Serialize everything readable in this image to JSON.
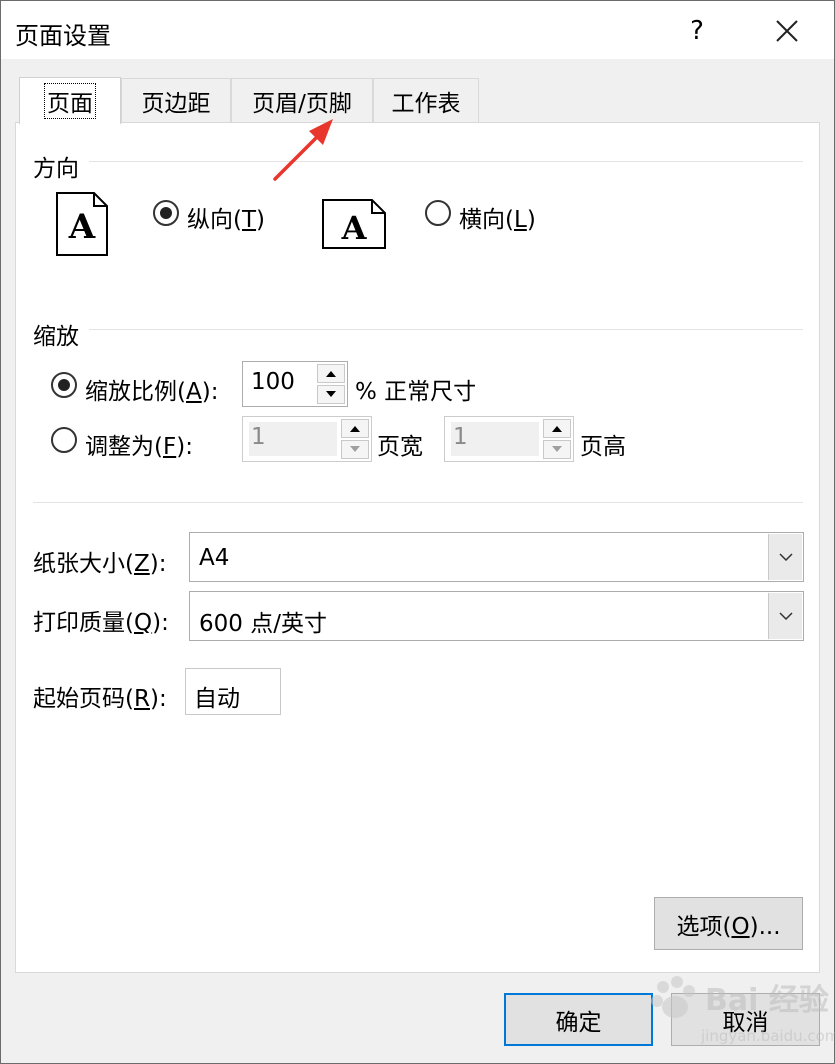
{
  "window": {
    "title": "页面设置",
    "help": "?"
  },
  "tabs": [
    {
      "label": "页面",
      "active": true
    },
    {
      "label": "页边距",
      "active": false
    },
    {
      "label": "页眉/页脚",
      "active": false
    },
    {
      "label": "工作表",
      "active": false
    }
  ],
  "orientation": {
    "title": "方向",
    "portrait": {
      "label": "纵向(",
      "key": "T",
      "suffix": ")",
      "checked": true
    },
    "landscape": {
      "label": "横向(",
      "key": "L",
      "suffix": ")",
      "checked": false
    },
    "icon_letter": "A"
  },
  "scaling": {
    "title": "缩放",
    "adjust_to": {
      "label": "缩放比例(",
      "key": "A",
      "suffix": "):",
      "checked": true,
      "value": "100",
      "unit": "% 正常尺寸"
    },
    "fit_to": {
      "label": "调整为(",
      "key": "F",
      "suffix": "):",
      "checked": false,
      "wide_value": "1",
      "wide_unit": "页宽",
      "tall_value": "1",
      "tall_unit": "页高"
    }
  },
  "paper_size": {
    "label": "纸张大小(",
    "key": "Z",
    "suffix": "):",
    "value": "A4"
  },
  "print_quality": {
    "label": "打印质量(",
    "key": "Q",
    "suffix": "):",
    "value": "600 点/英寸"
  },
  "first_page_number": {
    "label": "起始页码(",
    "key": "R",
    "suffix": "):",
    "value": "自动"
  },
  "buttons": {
    "options": {
      "label": "选项(",
      "key": "O",
      "suffix": ")..."
    },
    "ok": "确定",
    "cancel": "取消"
  },
  "watermark": {
    "text": "Bai 经验",
    "url": "jingyan.baidu.com"
  },
  "colors": {
    "accent": "#0078d7",
    "arrow": "#e8362d",
    "panel": "#ffffff",
    "dialog": "#f0f0f0"
  }
}
